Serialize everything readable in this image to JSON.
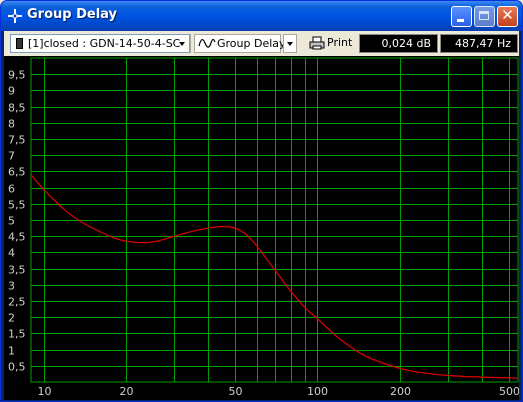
{
  "window": {
    "title": "Group Delay"
  },
  "toolbar": {
    "source_selected": "[1]closed : GDN-14-50-4-SC",
    "mode_label": "Group Delay",
    "print_label": "Print",
    "readout_db": "0,024 dB",
    "readout_hz": "487,47 Hz"
  },
  "icons": {
    "app": "crosshair-icon",
    "source": "device-icon",
    "mode": "waveform-icon",
    "print": "printer-icon"
  },
  "colors": {
    "plot_background": "#000000",
    "grid": "#00a000",
    "curve": "#e00000",
    "axis_text": "#d0d0d0"
  },
  "chart_data": {
    "type": "line",
    "x_scale": "log",
    "xlim": [
      9,
      540
    ],
    "ylim": [
      0,
      10
    ],
    "grid": true,
    "x_ticks": [
      {
        "value": 10,
        "label": "10"
      },
      {
        "value": 20,
        "label": "20"
      },
      {
        "value": 50,
        "label": "50"
      },
      {
        "value": 100,
        "label": "100"
      },
      {
        "value": 200,
        "label": "200"
      },
      {
        "value": 500,
        "label": "500"
      }
    ],
    "x_minor_grid": [
      30,
      40,
      60,
      70,
      80,
      90,
      300,
      400
    ],
    "y_ticks": [
      {
        "value": 0.5,
        "label": "0,5"
      },
      {
        "value": 1,
        "label": "1"
      },
      {
        "value": 1.5,
        "label": "1,5"
      },
      {
        "value": 2,
        "label": "2"
      },
      {
        "value": 2.5,
        "label": "2,5"
      },
      {
        "value": 3,
        "label": "3"
      },
      {
        "value": 3.5,
        "label": "3,5"
      },
      {
        "value": 4,
        "label": "4"
      },
      {
        "value": 4.5,
        "label": "4,5"
      },
      {
        "value": 5,
        "label": "5"
      },
      {
        "value": 5.5,
        "label": "5,5"
      },
      {
        "value": 6,
        "label": "6"
      },
      {
        "value": 6.5,
        "label": "6,5"
      },
      {
        "value": 7,
        "label": "7"
      },
      {
        "value": 7.5,
        "label": "7,5"
      },
      {
        "value": 8,
        "label": "8"
      },
      {
        "value": 8.5,
        "label": "8,5"
      },
      {
        "value": 9,
        "label": "9"
      },
      {
        "value": 9.5,
        "label": "9,5"
      }
    ],
    "series": [
      {
        "x": [
          9,
          10,
          12,
          14,
          16,
          18,
          20,
          23,
          26,
          30,
          35,
          40,
          45,
          50,
          55,
          60,
          70,
          80,
          90,
          100,
          120,
          150,
          200,
          250,
          300,
          400,
          500,
          540
        ],
        "y": [
          6.4,
          5.95,
          5.3,
          4.9,
          4.65,
          4.45,
          4.35,
          4.3,
          4.35,
          4.5,
          4.65,
          4.75,
          4.8,
          4.75,
          4.55,
          4.2,
          3.45,
          2.8,
          2.3,
          1.95,
          1.35,
          0.8,
          0.42,
          0.27,
          0.2,
          0.15,
          0.13,
          0.12
        ]
      }
    ]
  }
}
